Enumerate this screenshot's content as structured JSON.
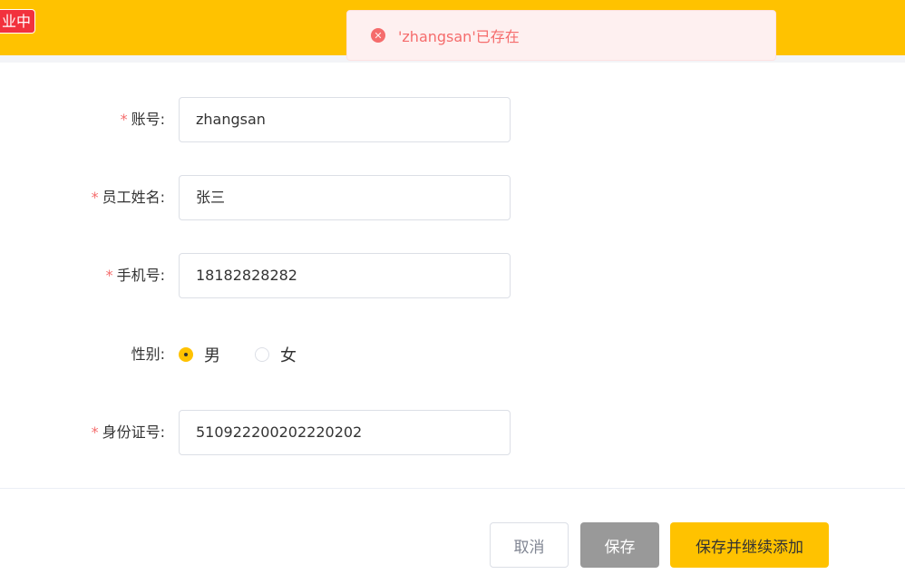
{
  "header": {
    "status_tag": "业中"
  },
  "toast": {
    "icon": "error-circle-icon",
    "message": "'zhangsan'已存在",
    "color": "#f56c6c"
  },
  "form": {
    "account": {
      "label": "账号:",
      "value": "zhangsan",
      "required": true
    },
    "name": {
      "label": "员工姓名:",
      "value": "张三",
      "required": true
    },
    "phone": {
      "label": "手机号:",
      "value": "18182828282",
      "required": true
    },
    "gender": {
      "label": "性别:",
      "required": false,
      "options": [
        {
          "label": "男",
          "selected": true
        },
        {
          "label": "女",
          "selected": false
        }
      ]
    },
    "id_number": {
      "label": "身份证号:",
      "value": "510922200202220202",
      "required": true
    }
  },
  "buttons": {
    "cancel": "取消",
    "save": "保存",
    "save_and_add": "保存并继续添加"
  },
  "colors": {
    "brand": "#ffc200",
    "required_mark": "#f56c6c",
    "save_disabled": "#999999"
  }
}
